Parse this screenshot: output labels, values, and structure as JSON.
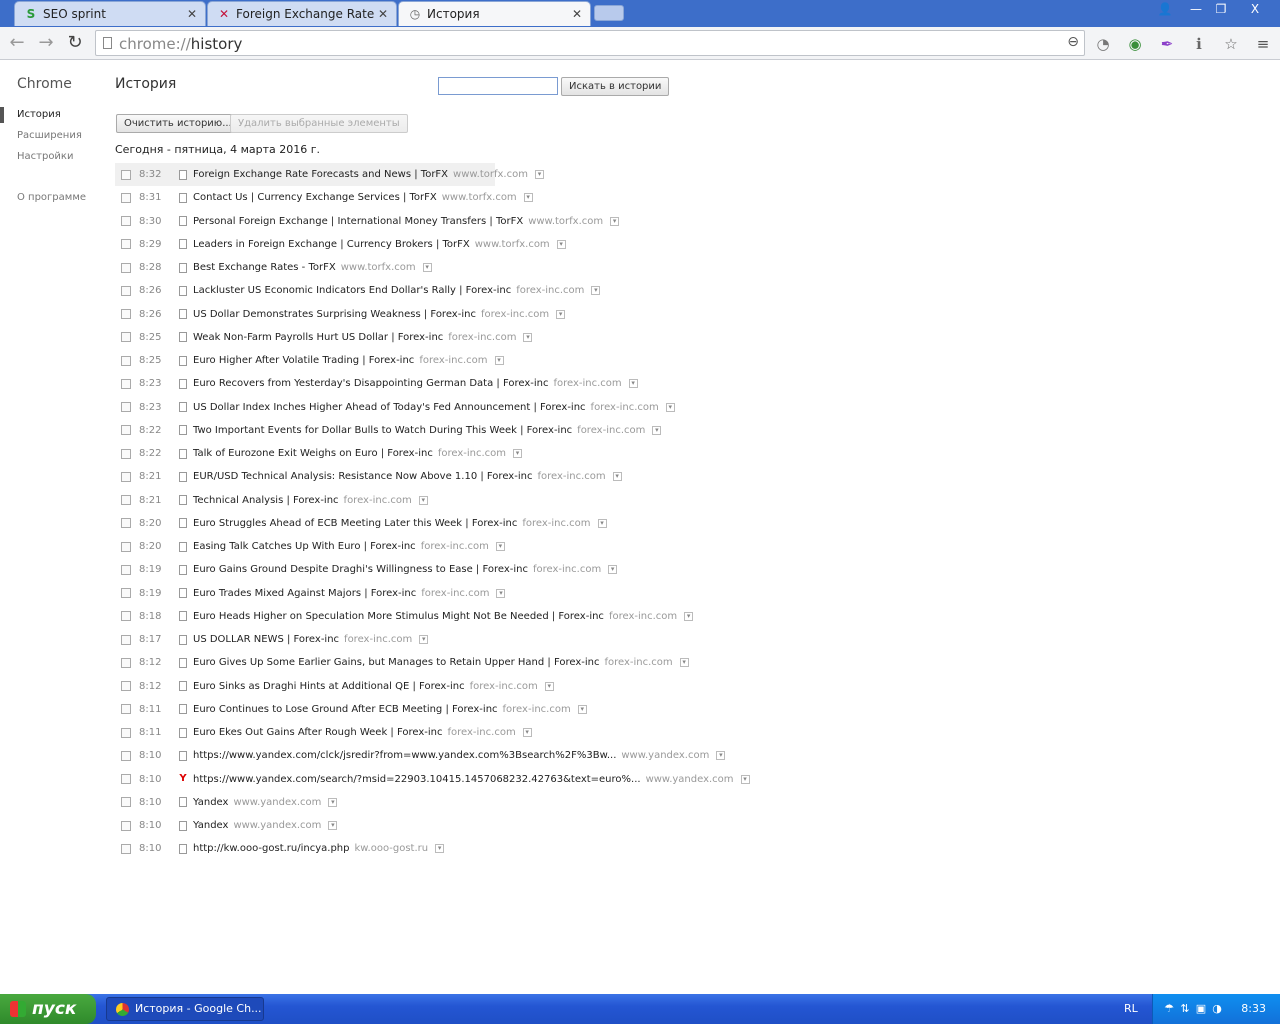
{
  "tabs": [
    {
      "title": "SEO sprint",
      "icon": "seo-sprint-icon",
      "active": false
    },
    {
      "title": "Foreign Exchange Rate Forecasts",
      "icon": "torfx-icon",
      "active": false
    },
    {
      "title": "История",
      "icon": "history-icon",
      "active": true
    }
  ],
  "window_controls": {
    "user": "👤",
    "minimize": "—",
    "restore": "❐",
    "close": "X"
  },
  "toolbar": {
    "back": "←",
    "forward": "→",
    "reload": "↻",
    "url_scheme": "chrome://",
    "url_path": "history",
    "zoom": "⊖"
  },
  "extensions": [
    {
      "name": "timer-off-extension-icon",
      "glyph": "◔",
      "color": "#777"
    },
    {
      "name": "globe-extension-icon",
      "glyph": "◉",
      "color": "#3a8f3a"
    },
    {
      "name": "feather-extension-icon",
      "glyph": "✒",
      "color": "#8b3fc9"
    },
    {
      "name": "info-extension-icon",
      "glyph": "ℹ",
      "color": "#666"
    },
    {
      "name": "bookmark-star-icon",
      "glyph": "☆",
      "color": "#666"
    },
    {
      "name": "menu-icon",
      "glyph": "≡",
      "color": "#555"
    }
  ],
  "sidebar": {
    "title": "Chrome",
    "items": [
      {
        "label": "История",
        "selected": true
      },
      {
        "label": "Расширения",
        "selected": false
      },
      {
        "label": "Настройки",
        "selected": false
      }
    ],
    "about": "О программе"
  },
  "main": {
    "title": "История",
    "search_button": "Искать в истории",
    "search_value": "",
    "clear_button": "Очистить историю...",
    "delete_button": "Удалить выбранные элементы",
    "day_header": "Сегодня - пятница, 4 марта 2016 г."
  },
  "entries": [
    {
      "time": "8:32",
      "title": "Foreign Exchange Rate Forecasts and News | TorFX",
      "domain": "www.torfx.com"
    },
    {
      "time": "8:31",
      "title": "Contact Us | Currency Exchange Services | TorFX",
      "domain": "www.torfx.com"
    },
    {
      "time": "8:30",
      "title": "Personal Foreign Exchange | International Money Transfers | TorFX",
      "domain": "www.torfx.com"
    },
    {
      "time": "8:29",
      "title": "Leaders in Foreign Exchange | Currency Brokers | TorFX",
      "domain": "www.torfx.com"
    },
    {
      "time": "8:28",
      "title": "Best Exchange Rates - TorFX",
      "domain": "www.torfx.com"
    },
    {
      "time": "8:26",
      "title": "Lackluster US Economic Indicators End Dollar's Rally | Forex-inc",
      "domain": "forex-inc.com"
    },
    {
      "time": "8:26",
      "title": "US Dollar Demonstrates Surprising Weakness | Forex-inc",
      "domain": "forex-inc.com"
    },
    {
      "time": "8:25",
      "title": "Weak Non-Farm Payrolls Hurt US Dollar | Forex-inc",
      "domain": "forex-inc.com"
    },
    {
      "time": "8:25",
      "title": "Euro Higher After Volatile Trading | Forex-inc",
      "domain": "forex-inc.com"
    },
    {
      "time": "8:23",
      "title": "Euro Recovers from Yesterday's Disappointing German Data | Forex-inc",
      "domain": "forex-inc.com"
    },
    {
      "time": "8:23",
      "title": "US Dollar Index Inches Higher Ahead of Today's Fed Announcement | Forex-inc",
      "domain": "forex-inc.com"
    },
    {
      "time": "8:22",
      "title": "Two Important Events for Dollar Bulls to Watch During This Week | Forex-inc",
      "domain": "forex-inc.com"
    },
    {
      "time": "8:22",
      "title": "Talk of Eurozone Exit Weighs on Euro | Forex-inc",
      "domain": "forex-inc.com"
    },
    {
      "time": "8:21",
      "title": "EUR/USD Technical Analysis: Resistance Now Above 1.10 | Forex-inc",
      "domain": "forex-inc.com"
    },
    {
      "time": "8:21",
      "title": "Technical Analysis | Forex-inc",
      "domain": "forex-inc.com"
    },
    {
      "time": "8:20",
      "title": "Euro Struggles Ahead of ECB Meeting Later this Week | Forex-inc",
      "domain": "forex-inc.com"
    },
    {
      "time": "8:20",
      "title": "Easing Talk Catches Up With Euro | Forex-inc",
      "domain": "forex-inc.com"
    },
    {
      "time": "8:19",
      "title": "Euro Gains Ground Despite Draghi's Willingness to Ease | Forex-inc",
      "domain": "forex-inc.com"
    },
    {
      "time": "8:19",
      "title": "Euro Trades Mixed Against Majors | Forex-inc",
      "domain": "forex-inc.com"
    },
    {
      "time": "8:18",
      "title": "Euro Heads Higher on Speculation More Stimulus Might Not Be Needed | Forex-inc",
      "domain": "forex-inc.com"
    },
    {
      "time": "8:17",
      "title": "US DOLLAR NEWS | Forex-inc",
      "domain": "forex-inc.com"
    },
    {
      "time": "8:12",
      "title": "Euro Gives Up Some Earlier Gains, but Manages to Retain Upper Hand | Forex-inc",
      "domain": "forex-inc.com"
    },
    {
      "time": "8:12",
      "title": "Euro Sinks as Draghi Hints at Additional QE | Forex-inc",
      "domain": "forex-inc.com"
    },
    {
      "time": "8:11",
      "title": "Euro Continues to Lose Ground After ECB Meeting | Forex-inc",
      "domain": "forex-inc.com"
    },
    {
      "time": "8:11",
      "title": "Euro Ekes Out Gains After Rough Week | Forex-inc",
      "domain": "forex-inc.com"
    },
    {
      "time": "8:10",
      "title": "https://www.yandex.com/clck/jsredir?from=www.yandex.com%3Bsearch%2F%3Bw...",
      "domain": "www.yandex.com"
    },
    {
      "time": "8:10",
      "title": "https://www.yandex.com/search/?msid=22903.10415.1457068232.42763&text=euro%...",
      "domain": "www.yandex.com",
      "icon": "yandex"
    },
    {
      "time": "8:10",
      "title": "Yandex",
      "domain": "www.yandex.com"
    },
    {
      "time": "8:10",
      "title": "Yandex",
      "domain": "www.yandex.com"
    },
    {
      "time": "8:10",
      "title": "http://kw.ooo-gost.ru/incya.php",
      "domain": "kw.ooo-gost.ru"
    }
  ],
  "taskbar": {
    "start_label": "пуск",
    "task_label": "История - Google Ch...",
    "language": "RL",
    "clock": "8:33"
  }
}
